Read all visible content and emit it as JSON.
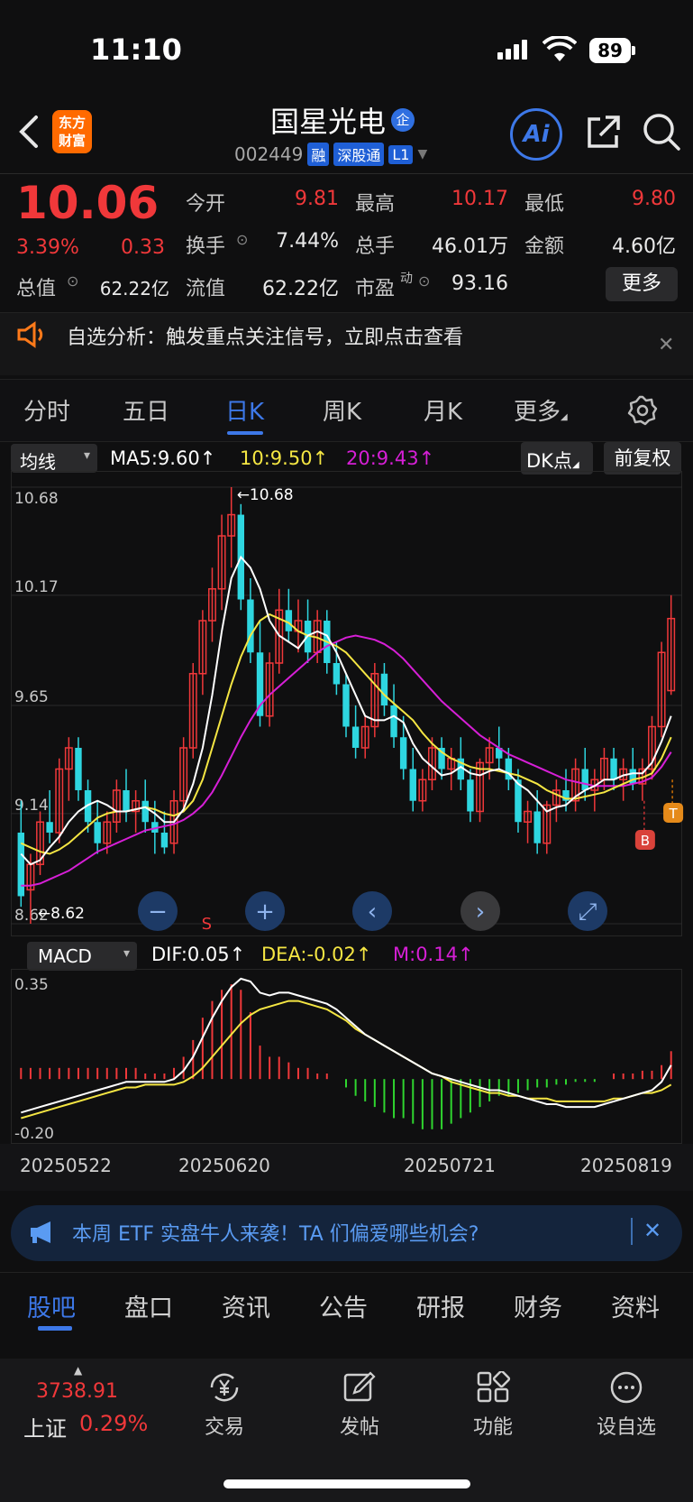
{
  "status_bar": {
    "time": "11:10",
    "battery": "89"
  },
  "header": {
    "logo_text": "东方\n财富",
    "stock_name": "国星光电",
    "badge": "企",
    "code": "002449",
    "tags": [
      "融",
      "深股通",
      "L1"
    ],
    "ai_label": "Ai"
  },
  "quote": {
    "price": "10.06",
    "change_pct": "3.39%",
    "change": "0.33",
    "fields": [
      {
        "label": "今开",
        "value": "9.81",
        "color": "red"
      },
      {
        "label": "最高",
        "value": "10.17",
        "color": "red"
      },
      {
        "label": "最低",
        "value": "9.80",
        "color": "red"
      },
      {
        "label": "换手",
        "value": "7.44%",
        "color": "white"
      },
      {
        "label": "总手",
        "value": "46.01万",
        "color": "white"
      },
      {
        "label": "金额",
        "value": "4.60亿",
        "color": "white"
      },
      {
        "label": "总值",
        "value": "62.22亿",
        "color": "white"
      },
      {
        "label": "流值",
        "value": "62.22亿",
        "color": "white"
      },
      {
        "label": "市盈",
        "value": "93.16",
        "color": "white"
      }
    ],
    "pe_sup": "动",
    "more": "更多"
  },
  "alert": {
    "text": "自选分析：触发重点关注信号，立即点击查看"
  },
  "period_tabs": [
    "分时",
    "五日",
    "日K",
    "周K",
    "月K",
    "更多"
  ],
  "indicator": {
    "ma_dropdown": "均线",
    "ma5": "MA5:9.60",
    "ma10": "10:9.50",
    "ma20": "20:9.43",
    "dk_button": "DK点",
    "adjust_button": "前复权",
    "macd_dropdown": "MACD",
    "dif": "DIF:0.05",
    "dea": "DEA:-0.02",
    "m": "M:0.14",
    "arrow": "↑"
  },
  "colors": {
    "up": "#f0383a",
    "down": "#2ed6e0",
    "ma5": "#ffffff",
    "ma10": "#f5e643",
    "ma20": "#d61fd6",
    "accent": "#3d78e8"
  },
  "chart_data": [
    {
      "type": "candlestick",
      "y_axis_labels": [
        "10.68",
        "10.17",
        "9.65",
        "9.14",
        "8.62"
      ],
      "ylim": [
        8.62,
        10.68
      ],
      "high_marker": "←10.68",
      "low_marker": "←8.62",
      "signals": [
        "S",
        "B",
        "T"
      ],
      "candles": [
        [
          9.05,
          9.2,
          8.7,
          8.75
        ],
        [
          8.78,
          8.95,
          8.62,
          8.9
        ],
        [
          8.9,
          9.15,
          8.85,
          9.1
        ],
        [
          9.1,
          9.25,
          9.0,
          9.05
        ],
        [
          9.05,
          9.4,
          9.0,
          9.35
        ],
        [
          9.35,
          9.5,
          9.2,
          9.45
        ],
        [
          9.45,
          9.5,
          9.2,
          9.25
        ],
        [
          9.25,
          9.3,
          9.05,
          9.1
        ],
        [
          9.1,
          9.2,
          8.95,
          9.0
        ],
        [
          9.0,
          9.15,
          8.95,
          9.1
        ],
        [
          9.1,
          9.3,
          9.05,
          9.25
        ],
        [
          9.25,
          9.35,
          9.1,
          9.15
        ],
        [
          9.15,
          9.25,
          9.05,
          9.2
        ],
        [
          9.2,
          9.3,
          9.05,
          9.1
        ],
        [
          9.1,
          9.2,
          8.95,
          9.05
        ],
        [
          9.05,
          9.15,
          8.95,
          8.98
        ],
        [
          9.0,
          9.25,
          8.95,
          9.2
        ],
        [
          9.2,
          9.5,
          9.15,
          9.45
        ],
        [
          9.45,
          9.85,
          9.4,
          9.8
        ],
        [
          9.8,
          10.1,
          9.7,
          10.05
        ],
        [
          10.05,
          10.3,
          9.95,
          10.2
        ],
        [
          10.2,
          10.55,
          10.1,
          10.45
        ],
        [
          10.45,
          10.68,
          10.3,
          10.55
        ],
        [
          10.55,
          10.6,
          10.1,
          10.15
        ],
        [
          10.15,
          10.25,
          9.85,
          9.9
        ],
        [
          9.9,
          10.05,
          9.55,
          9.6
        ],
        [
          9.6,
          9.9,
          9.55,
          9.85
        ],
        [
          9.85,
          10.2,
          9.8,
          10.1
        ],
        [
          10.1,
          10.2,
          9.95,
          10.0
        ],
        [
          10.0,
          10.15,
          9.9,
          10.05
        ],
        [
          10.05,
          10.15,
          9.85,
          9.9
        ],
        [
          9.9,
          10.1,
          9.85,
          10.05
        ],
        [
          10.05,
          10.1,
          9.8,
          9.85
        ],
        [
          9.85,
          9.95,
          9.7,
          9.75
        ],
        [
          9.75,
          9.8,
          9.5,
          9.55
        ],
        [
          9.55,
          9.65,
          9.4,
          9.45
        ],
        [
          9.45,
          9.6,
          9.4,
          9.55
        ],
        [
          9.55,
          9.85,
          9.5,
          9.8
        ],
        [
          9.8,
          9.85,
          9.6,
          9.65
        ],
        [
          9.65,
          9.75,
          9.45,
          9.5
        ],
        [
          9.5,
          9.6,
          9.3,
          9.35
        ],
        [
          9.35,
          9.45,
          9.15,
          9.2
        ],
        [
          9.2,
          9.35,
          9.15,
          9.3
        ],
        [
          9.3,
          9.5,
          9.25,
          9.45
        ],
        [
          9.45,
          9.5,
          9.3,
          9.35
        ],
        [
          9.35,
          9.45,
          9.25,
          9.4
        ],
        [
          9.4,
          9.5,
          9.25,
          9.3
        ],
        [
          9.3,
          9.35,
          9.1,
          9.15
        ],
        [
          9.15,
          9.4,
          9.1,
          9.38
        ],
        [
          9.38,
          9.5,
          9.3,
          9.45
        ],
        [
          9.45,
          9.55,
          9.35,
          9.4
        ],
        [
          9.4,
          9.45,
          9.25,
          9.3
        ],
        [
          9.3,
          9.35,
          9.05,
          9.1
        ],
        [
          9.1,
          9.2,
          9.0,
          9.15
        ],
        [
          9.15,
          9.25,
          8.95,
          9.0
        ],
        [
          9.0,
          9.2,
          8.95,
          9.18
        ],
        [
          9.18,
          9.3,
          9.1,
          9.25
        ],
        [
          9.25,
          9.35,
          9.15,
          9.2
        ],
        [
          9.2,
          9.4,
          9.15,
          9.35
        ],
        [
          9.35,
          9.45,
          9.2,
          9.25
        ],
        [
          9.25,
          9.35,
          9.15,
          9.3
        ],
        [
          9.3,
          9.45,
          9.25,
          9.4
        ],
        [
          9.4,
          9.45,
          9.25,
          9.3
        ],
        [
          9.3,
          9.4,
          9.2,
          9.35
        ],
        [
          9.35,
          9.45,
          9.25,
          9.28
        ],
        [
          9.28,
          9.4,
          9.2,
          9.35
        ],
        [
          9.35,
          9.6,
          9.3,
          9.55
        ],
        [
          9.55,
          9.95,
          9.5,
          9.9
        ],
        [
          9.72,
          10.17,
          9.7,
          10.06
        ]
      ],
      "ma5": [
        8.95,
        8.9,
        8.92,
        8.98,
        9.03,
        9.1,
        9.15,
        9.18,
        9.2,
        9.18,
        9.15,
        9.15,
        9.16,
        9.17,
        9.14,
        9.1,
        9.1,
        9.16,
        9.28,
        9.45,
        9.7,
        10.0,
        10.25,
        10.35,
        10.3,
        10.2,
        10.05,
        9.98,
        9.95,
        9.92,
        9.98,
        10.0,
        9.98,
        9.9,
        9.8,
        9.7,
        9.6,
        9.58,
        9.58,
        9.6,
        9.57,
        9.47,
        9.4,
        9.36,
        9.32,
        9.33,
        9.36,
        9.33,
        9.32,
        9.34,
        9.35,
        9.33,
        9.28,
        9.25,
        9.2,
        9.15,
        9.17,
        9.18,
        9.22,
        9.25,
        9.27,
        9.3,
        9.3,
        9.32,
        9.33,
        9.33,
        9.38,
        9.48,
        9.6
      ],
      "ma10": [
        9.0,
        8.98,
        8.96,
        8.95,
        8.97,
        9.0,
        9.04,
        9.08,
        9.12,
        9.14,
        9.15,
        9.15,
        9.16,
        9.17,
        9.16,
        9.14,
        9.13,
        9.15,
        9.2,
        9.3,
        9.45,
        9.6,
        9.75,
        9.88,
        9.98,
        10.05,
        10.08,
        10.06,
        10.04,
        10.0,
        9.98,
        9.97,
        9.95,
        9.93,
        9.9,
        9.85,
        9.8,
        9.75,
        9.7,
        9.66,
        9.62,
        9.58,
        9.52,
        9.47,
        9.43,
        9.4,
        9.38,
        9.36,
        9.35,
        9.35,
        9.34,
        9.33,
        9.32,
        9.3,
        9.28,
        9.25,
        9.23,
        9.21,
        9.21,
        9.22,
        9.23,
        9.24,
        9.26,
        9.28,
        9.3,
        9.31,
        9.33,
        9.4,
        9.5
      ],
      "ma20": [
        8.8,
        8.8,
        8.81,
        8.83,
        8.85,
        8.87,
        8.9,
        8.93,
        8.96,
        8.98,
        9.0,
        9.02,
        9.04,
        9.06,
        9.07,
        9.08,
        9.09,
        9.11,
        9.14,
        9.18,
        9.24,
        9.32,
        9.41,
        9.5,
        9.58,
        9.65,
        9.7,
        9.74,
        9.78,
        9.82,
        9.86,
        9.9,
        9.93,
        9.95,
        9.97,
        9.98,
        9.97,
        9.96,
        9.94,
        9.91,
        9.87,
        9.82,
        9.77,
        9.72,
        9.67,
        9.63,
        9.59,
        9.55,
        9.51,
        9.48,
        9.45,
        9.42,
        9.4,
        9.38,
        9.36,
        9.34,
        9.32,
        9.3,
        9.29,
        9.28,
        9.27,
        9.27,
        9.27,
        9.27,
        9.28,
        9.29,
        9.31,
        9.36,
        9.43
      ]
    },
    {
      "type": "bar",
      "name": "MACD",
      "y_axis_labels": [
        "0.35",
        "-0.20"
      ],
      "ylim": [
        -0.2,
        0.35
      ],
      "dif": [
        -0.12,
        -0.11,
        -0.1,
        -0.09,
        -0.08,
        -0.07,
        -0.06,
        -0.05,
        -0.04,
        -0.03,
        -0.02,
        -0.01,
        -0.01,
        -0.01,
        -0.01,
        -0.01,
        0.0,
        0.03,
        0.08,
        0.15,
        0.22,
        0.28,
        0.33,
        0.36,
        0.35,
        0.31,
        0.3,
        0.31,
        0.31,
        0.3,
        0.29,
        0.28,
        0.27,
        0.25,
        0.22,
        0.19,
        0.16,
        0.14,
        0.12,
        0.1,
        0.08,
        0.06,
        0.04,
        0.02,
        0.01,
        0.0,
        -0.01,
        -0.02,
        -0.03,
        -0.04,
        -0.04,
        -0.05,
        -0.06,
        -0.07,
        -0.08,
        -0.09,
        -0.09,
        -0.1,
        -0.1,
        -0.1,
        -0.1,
        -0.09,
        -0.08,
        -0.07,
        -0.06,
        -0.05,
        -0.04,
        -0.01,
        0.05
      ],
      "dea": [
        -0.14,
        -0.13,
        -0.12,
        -0.11,
        -0.1,
        -0.09,
        -0.08,
        -0.07,
        -0.06,
        -0.05,
        -0.04,
        -0.03,
        -0.03,
        -0.02,
        -0.02,
        -0.02,
        -0.02,
        -0.01,
        0.01,
        0.04,
        0.08,
        0.12,
        0.16,
        0.2,
        0.23,
        0.25,
        0.26,
        0.27,
        0.28,
        0.28,
        0.27,
        0.26,
        0.25,
        0.23,
        0.21,
        0.18,
        0.16,
        0.14,
        0.12,
        0.1,
        0.08,
        0.06,
        0.04,
        0.02,
        0.01,
        -0.01,
        -0.02,
        -0.03,
        -0.04,
        -0.05,
        -0.05,
        -0.06,
        -0.06,
        -0.07,
        -0.07,
        -0.07,
        -0.08,
        -0.08,
        -0.08,
        -0.08,
        -0.08,
        -0.08,
        -0.07,
        -0.07,
        -0.06,
        -0.05,
        -0.05,
        -0.04,
        -0.02
      ],
      "hist": [
        0.04,
        0.04,
        0.04,
        0.04,
        0.04,
        0.04,
        0.04,
        0.04,
        0.04,
        0.04,
        0.04,
        0.04,
        0.04,
        0.02,
        0.02,
        0.02,
        0.04,
        0.08,
        0.14,
        0.22,
        0.28,
        0.32,
        0.34,
        0.32,
        0.24,
        0.12,
        0.08,
        0.08,
        0.06,
        0.04,
        0.04,
        0.02,
        0.02,
        0.0,
        -0.03,
        -0.06,
        -0.08,
        -0.1,
        -0.12,
        -0.14,
        -0.14,
        -0.16,
        -0.18,
        -0.18,
        -0.18,
        -0.16,
        -0.14,
        -0.12,
        -0.1,
        -0.08,
        -0.06,
        -0.06,
        -0.05,
        -0.04,
        -0.03,
        -0.03,
        -0.02,
        -0.02,
        -0.01,
        -0.01,
        -0.01,
        0.0,
        0.02,
        0.02,
        0.02,
        0.03,
        0.03,
        0.05,
        0.1
      ]
    }
  ],
  "date_axis": [
    "20250522",
    "20250620",
    "20250721",
    "20250819"
  ],
  "promo": {
    "text": "本周 ETF 实盘牛人来袭！TA 们偏爱哪些机会?"
  },
  "bottom_tabs": [
    "股吧",
    "盘口",
    "资讯",
    "公告",
    "研报",
    "财务",
    "资料"
  ],
  "bottom_nav": {
    "index_value": "3738.91",
    "index_name": "上证",
    "index_pct": "0.29%",
    "items": [
      "交易",
      "发帖",
      "功能",
      "设自选"
    ]
  }
}
